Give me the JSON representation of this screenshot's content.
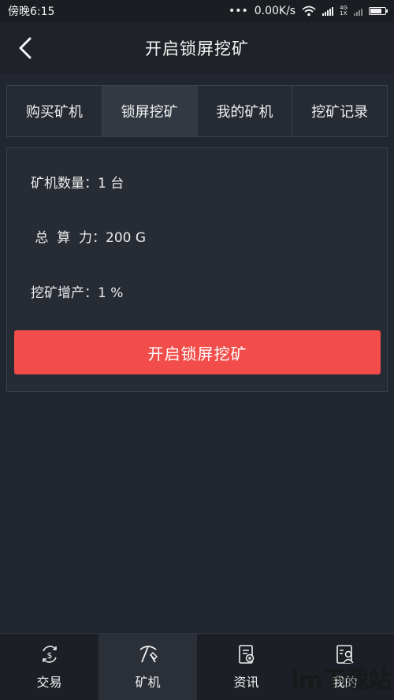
{
  "status_bar": {
    "time": "傍晚6:15",
    "dots": "•••",
    "speed": "0.00K/s",
    "net_4g": "4G",
    "net_1x": "1X"
  },
  "header": {
    "title": "开启锁屏挖矿",
    "back_icon": "chevron-left-icon"
  },
  "tabs": [
    {
      "label": "购买矿机",
      "active": false
    },
    {
      "label": "锁屏挖矿",
      "active": true
    },
    {
      "label": "我的矿机",
      "active": false
    },
    {
      "label": "挖矿记录",
      "active": false
    }
  ],
  "info": {
    "miner_count": "矿机数量：1 台",
    "total_power": " 总  算  力：200 G",
    "mining_boost": "挖矿增产：1 %"
  },
  "start_button": "开启锁屏挖矿",
  "bottom_nav": [
    {
      "label": "交易",
      "icon": "exchange-icon",
      "active": false
    },
    {
      "label": "矿机",
      "icon": "pickaxe-icon",
      "active": true
    },
    {
      "label": "资讯",
      "icon": "news-icon",
      "active": false
    },
    {
      "label": "我的",
      "icon": "profile-icon",
      "active": false
    }
  ],
  "watermark": "im下载站",
  "colors": {
    "background": "#22262e",
    "accent_button": "#f24d4a",
    "active_tab": "#333942"
  }
}
